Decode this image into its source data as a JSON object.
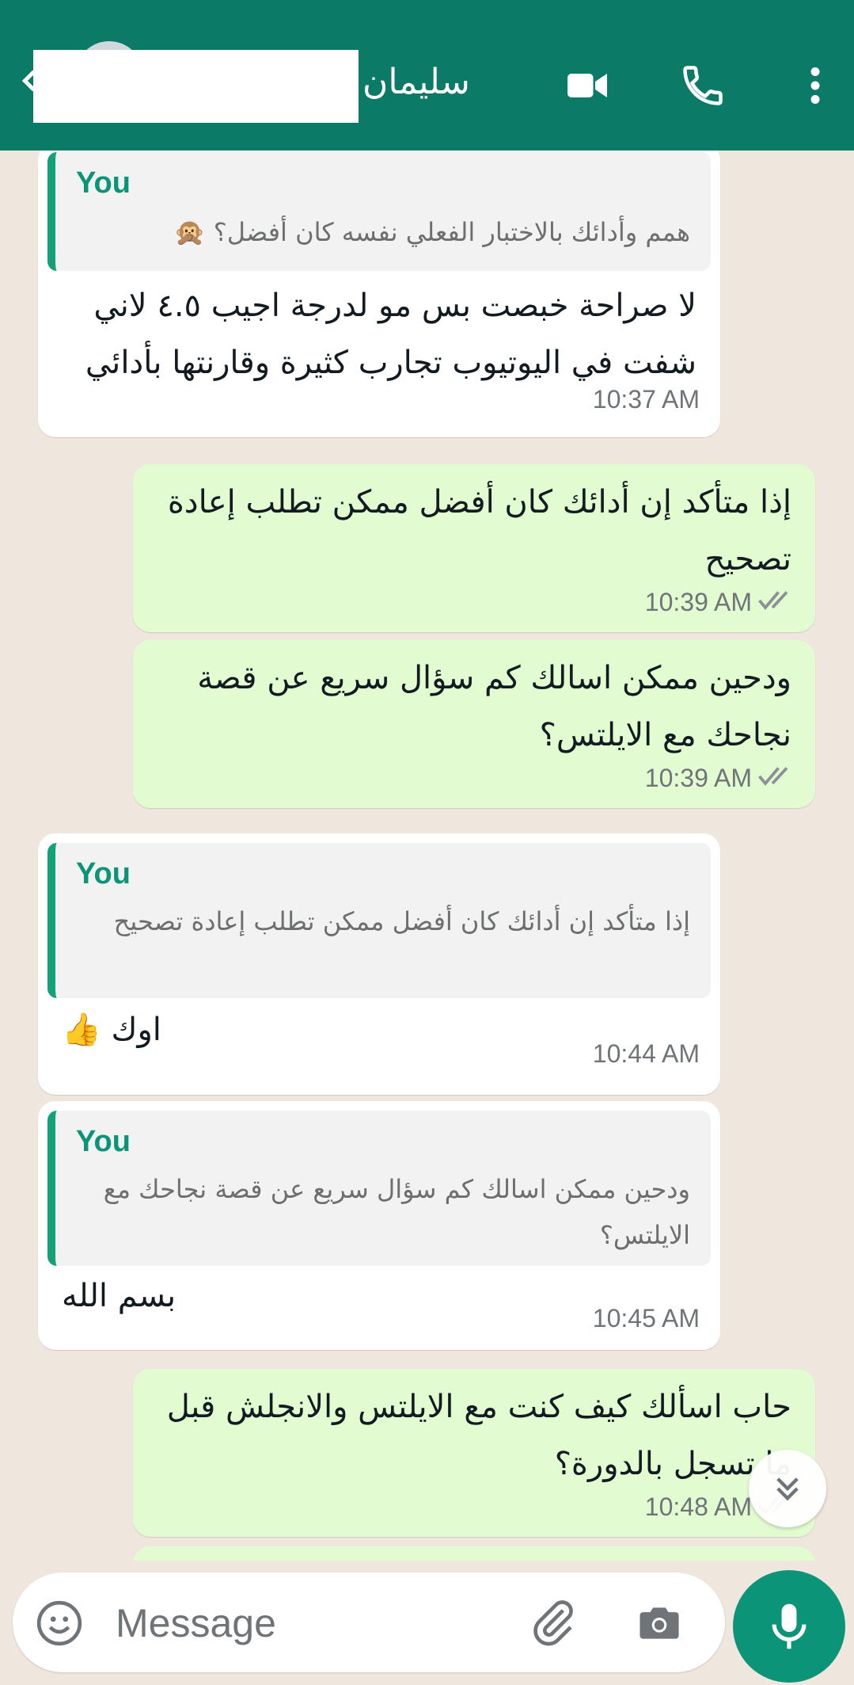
{
  "header": {
    "contact_name": "سليمان"
  },
  "messages": [
    {
      "type": "incoming",
      "quote_author": "You",
      "quote_text": "همم وأدائك بالاختبار الفعلي نفسه كان أفضل؟ 🙊",
      "text": "لا صراحة خبصت بس مو لدرجة اجيب ٤.٥ لاني شفت في اليوتيوب تجارب كثيرة وقارنتها بأدائي",
      "time": "10:37 AM"
    },
    {
      "type": "outgoing",
      "text": "إذا متأكد إن أدائك كان أفضل ممكن تطلب إعادة تصحيح",
      "time": "10:39 AM"
    },
    {
      "type": "outgoing",
      "text": "ودحين ممكن اسالك كم سؤال سريع عن قصة نجاحك مع الايلتس؟",
      "time": "10:39 AM"
    },
    {
      "type": "incoming",
      "quote_author": "You",
      "quote_text": "إذا متأكد إن أدائك كان أفضل ممكن تطلب إعادة تصحيح",
      "text": "اوك 👍",
      "time": "10:44 AM"
    },
    {
      "type": "incoming",
      "quote_author": "You",
      "quote_text": "ودحين ممكن اسالك كم سؤال سريع عن قصة نجاحك مع الايلتس؟",
      "text": "بسم الله",
      "time": "10:45 AM"
    },
    {
      "type": "outgoing",
      "text": "حاب اسألك كيف كنت مع الايلتس والانجلش قبل ما تسجل بالدورة؟",
      "time": "10:48 AM"
    }
  ],
  "input": {
    "placeholder": "Message"
  },
  "colors": {
    "header": "#0b7a67",
    "outgoing_bubble": "#e3fbd1",
    "accent": "#0b9477",
    "chat_bg": "#efe7de"
  }
}
